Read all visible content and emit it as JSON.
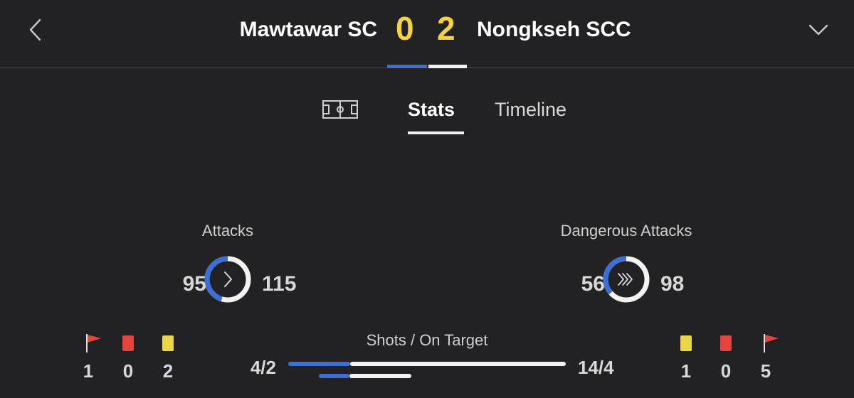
{
  "header": {
    "home_team": "Mawtawar SC",
    "away_team": "Nongkseh SCC",
    "home_score": "0",
    "away_score": "2",
    "back_icon": "chevron-left-icon",
    "collapse_icon": "chevron-down-icon"
  },
  "tabs": {
    "pitch_icon": "pitch-icon",
    "stats_label": "Stats",
    "timeline_label": "Timeline",
    "active": "Stats"
  },
  "attacks": {
    "label": "Attacks",
    "home": "95",
    "away": "115",
    "home_value": 95,
    "away_value": 115,
    "icon": "single-chevron-icon"
  },
  "dangerous_attacks": {
    "label": "Dangerous Attacks",
    "home": "56",
    "away": "98",
    "home_value": 56,
    "away_value": 98,
    "icon": "triple-chevron-icon"
  },
  "home_events": {
    "corners": "1",
    "red_cards": "0",
    "yellow_cards": "2"
  },
  "away_events": {
    "yellow_cards": "1",
    "red_cards": "0",
    "corners": "5"
  },
  "shots": {
    "label": "Shots / On Target",
    "home": "4/2",
    "away": "14/4",
    "home_shots": 4,
    "away_shots": 14,
    "home_on_target": 2,
    "away_on_target": 4
  },
  "colors": {
    "background": "#222224",
    "home": "#3b6fd6",
    "away": "#f2f2f2",
    "score": "#f5d33a",
    "red_card": "#e5443a",
    "yellow_card": "#ecd547",
    "corner_flag": "#e5443a"
  }
}
